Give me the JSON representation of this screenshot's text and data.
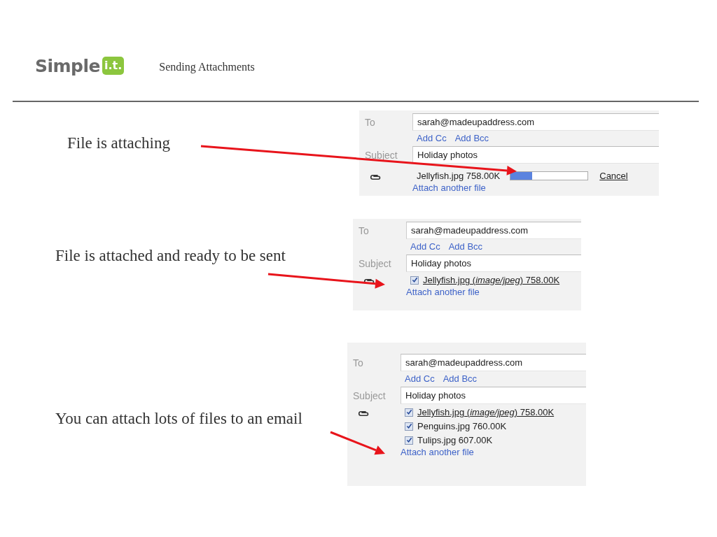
{
  "header": {
    "logo": {
      "word": "Simple",
      "badge": "i.t."
    },
    "title": "Sending Attachments"
  },
  "steps": [
    {
      "caption": "File is attaching",
      "form": {
        "to_label": "To",
        "to": "sarah@madeupaddress.com",
        "links": [
          "Add Cc",
          "Add Bcc"
        ],
        "subject_label": "Subject",
        "subject": "Holiday photos",
        "attachments": [
          {
            "kind": "uploading",
            "text": "Jellyfish.jpg 758.00K",
            "level": 0.28,
            "cancel": "Cancel"
          }
        ],
        "attach_link": "Attach another file"
      }
    },
    {
      "caption": "File is attached and ready to be sent",
      "form": {
        "to_label": "To",
        "to": "sarah@madeupaddress.com",
        "links": [
          "Add Cc",
          "Add Bcc"
        ],
        "subject_label": "Subject",
        "subject": "Holiday photos",
        "attachments": [
          {
            "kind": "attached",
            "checked": true,
            "underlined": true,
            "text": "Jellyfish.jpg (*image/jpeg*) 758.00K"
          }
        ],
        "attach_link": "Attach another file"
      }
    },
    {
      "caption": "You can attach lots of files to an email",
      "form": {
        "to_label": "To",
        "to": "sarah@madeupaddress.com",
        "links": [
          "Add Cc",
          "Add Bcc"
        ],
        "subject_label": "Subject",
        "subject": "Holiday photos",
        "attachments": [
          {
            "kind": "attached",
            "checked": true,
            "underlined": true,
            "text": "Jellyfish.jpg (*image/jpeg*) 758.00K"
          },
          {
            "kind": "attached",
            "checked": true,
            "underlined": false,
            "text": "Penguins.jpg 760.00K"
          },
          {
            "kind": "attached",
            "checked": true,
            "underlined": false,
            "text": "Tulips.jpg 607.00K"
          }
        ],
        "attach_link": "Attach another file"
      }
    }
  ]
}
